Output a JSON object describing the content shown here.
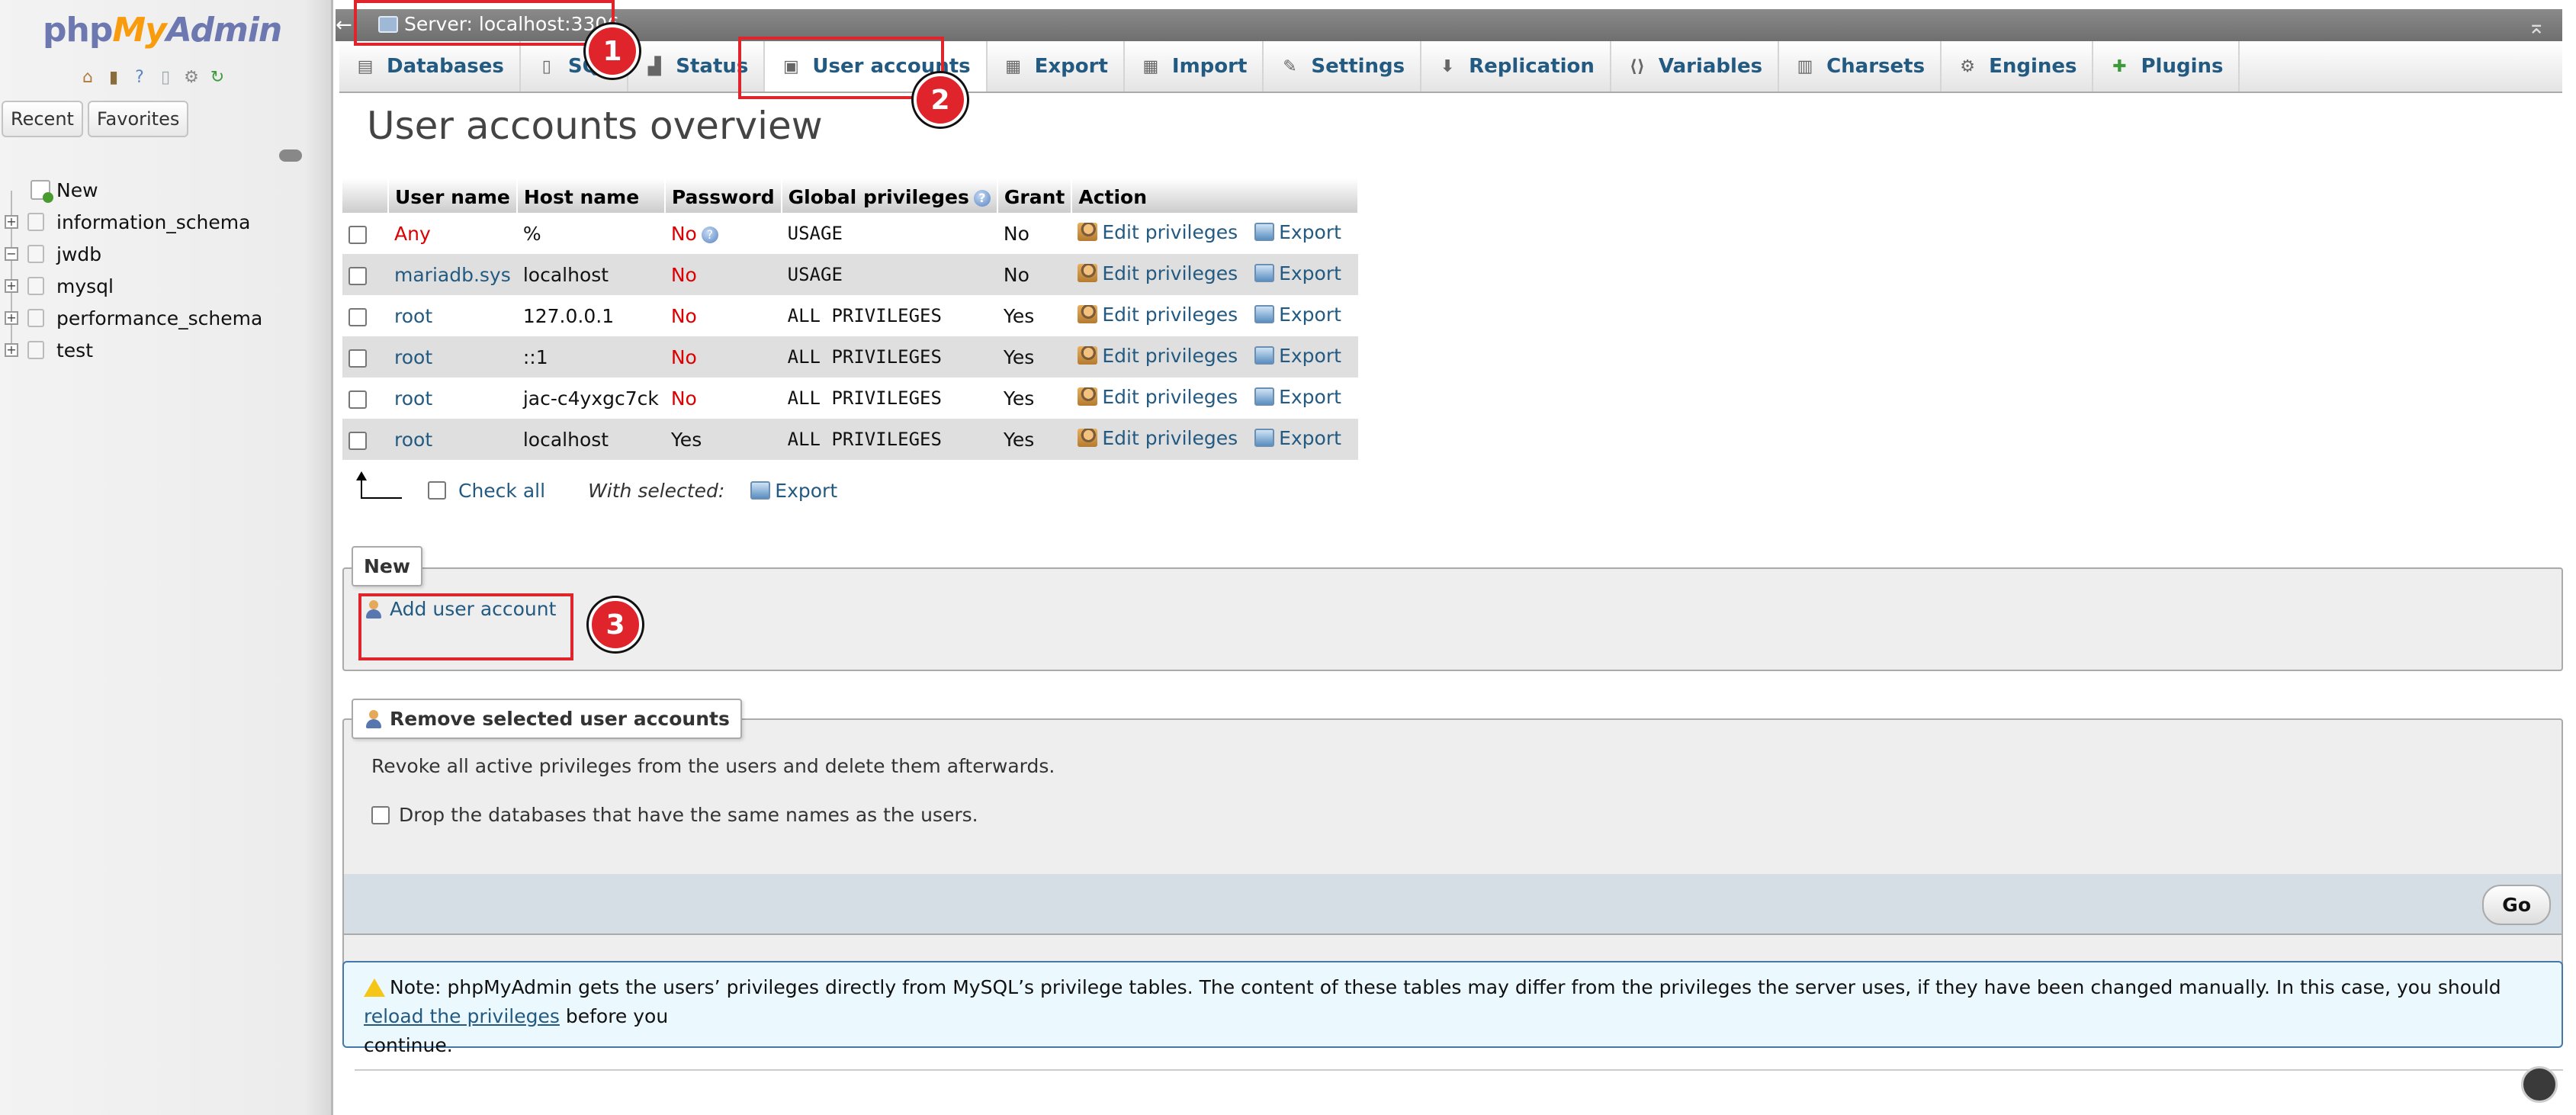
{
  "navigation": {
    "logo_parts": [
      "php",
      "My",
      "Admin"
    ],
    "icons": [
      "home-icon",
      "exit-icon",
      "help-icon",
      "docs-icon",
      "settings-icon",
      "reload-icon"
    ],
    "tabs": [
      "Recent",
      "Favorites"
    ],
    "tree": [
      {
        "label": "New",
        "expandable": false
      },
      {
        "label": "information_schema",
        "expandable": true,
        "sign": "+"
      },
      {
        "label": "jwdb",
        "expandable": true,
        "sign": "−"
      },
      {
        "label": "mysql",
        "expandable": true,
        "sign": "+"
      },
      {
        "label": "performance_schema",
        "expandable": true,
        "sign": "+"
      },
      {
        "label": "test",
        "expandable": true,
        "sign": "+"
      }
    ]
  },
  "serverbar": {
    "back": "←",
    "server_label": "Server: localhost:3306",
    "hide": "⌅"
  },
  "menu": {
    "tabs": [
      {
        "label": "Databases",
        "icon": "database-icon",
        "glyph": "▤"
      },
      {
        "label": "SQL",
        "icon": "sql-icon",
        "glyph": "▯"
      },
      {
        "label": "Status",
        "icon": "status-icon",
        "glyph": "▟"
      },
      {
        "label": "User accounts",
        "icon": "user-accounts-icon",
        "glyph": "▣",
        "active": true
      },
      {
        "label": "Export",
        "icon": "export-icon",
        "glyph": "▦"
      },
      {
        "label": "Import",
        "icon": "import-icon",
        "glyph": "▦"
      },
      {
        "label": "Settings",
        "icon": "wrench-icon",
        "glyph": "✎"
      },
      {
        "label": "Replication",
        "icon": "replication-icon",
        "glyph": "⬇"
      },
      {
        "label": "Variables",
        "icon": "variables-icon",
        "glyph": "⟨⟩"
      },
      {
        "label": "Charsets",
        "icon": "charsets-icon",
        "glyph": "▥"
      },
      {
        "label": "Engines",
        "icon": "engines-icon",
        "glyph": "⚙"
      },
      {
        "label": "Plugins",
        "icon": "plugins-icon",
        "glyph": "✚"
      }
    ]
  },
  "main": {
    "title": "User accounts overview",
    "table": {
      "headers": [
        "User name",
        "Host name",
        "Password",
        "Global privileges",
        "Grant",
        "Action"
      ],
      "rows": [
        {
          "user": "Any",
          "user_any": true,
          "host": "%",
          "password": "No",
          "pw_help": true,
          "privileges": "USAGE",
          "grant": "No"
        },
        {
          "user": "mariadb.sys",
          "host": "localhost",
          "password": "No",
          "privileges": "USAGE",
          "grant": "No"
        },
        {
          "user": "root",
          "host": "127.0.0.1",
          "password": "No",
          "privileges": "ALL PRIVILEGES",
          "grant": "Yes"
        },
        {
          "user": "root",
          "host": "::1",
          "password": "No",
          "privileges": "ALL PRIVILEGES",
          "grant": "Yes"
        },
        {
          "user": "root",
          "host": "jac-c4yxgc7ck",
          "password": "No",
          "privileges": "ALL PRIVILEGES",
          "grant": "Yes"
        },
        {
          "user": "root",
          "host": "localhost",
          "password": "Yes",
          "privileges": "ALL PRIVILEGES",
          "grant": "Yes"
        }
      ],
      "action_edit": "Edit privileges",
      "action_export": "Export"
    },
    "check_all": "Check all",
    "with_selected": "With selected:",
    "with_selected_export": "Export",
    "new_legend": "New",
    "add_user": "Add user account",
    "remove_legend": "Remove selected user accounts",
    "revoke_text": "Revoke all active privileges from the users and delete them afterwards.",
    "drop_db_text": "Drop the databases that have the same names as the users.",
    "go": "Go",
    "note_prefix": "Note: phpMyAdmin gets the users’ privileges directly from MySQL’s privilege tables. The content of these tables may differ from the privileges the server uses, if they have been changed manually. In this case, you should ",
    "note_link": "reload the privileges",
    "note_suffix": " before you",
    "note_continue": "continue."
  },
  "annotations": [
    "1",
    "2",
    "3"
  ],
  "colors": {
    "link": "#235a81",
    "danger": "#dd0000",
    "annotation": "#e0242b",
    "note_bg": "#ebf8fd"
  }
}
